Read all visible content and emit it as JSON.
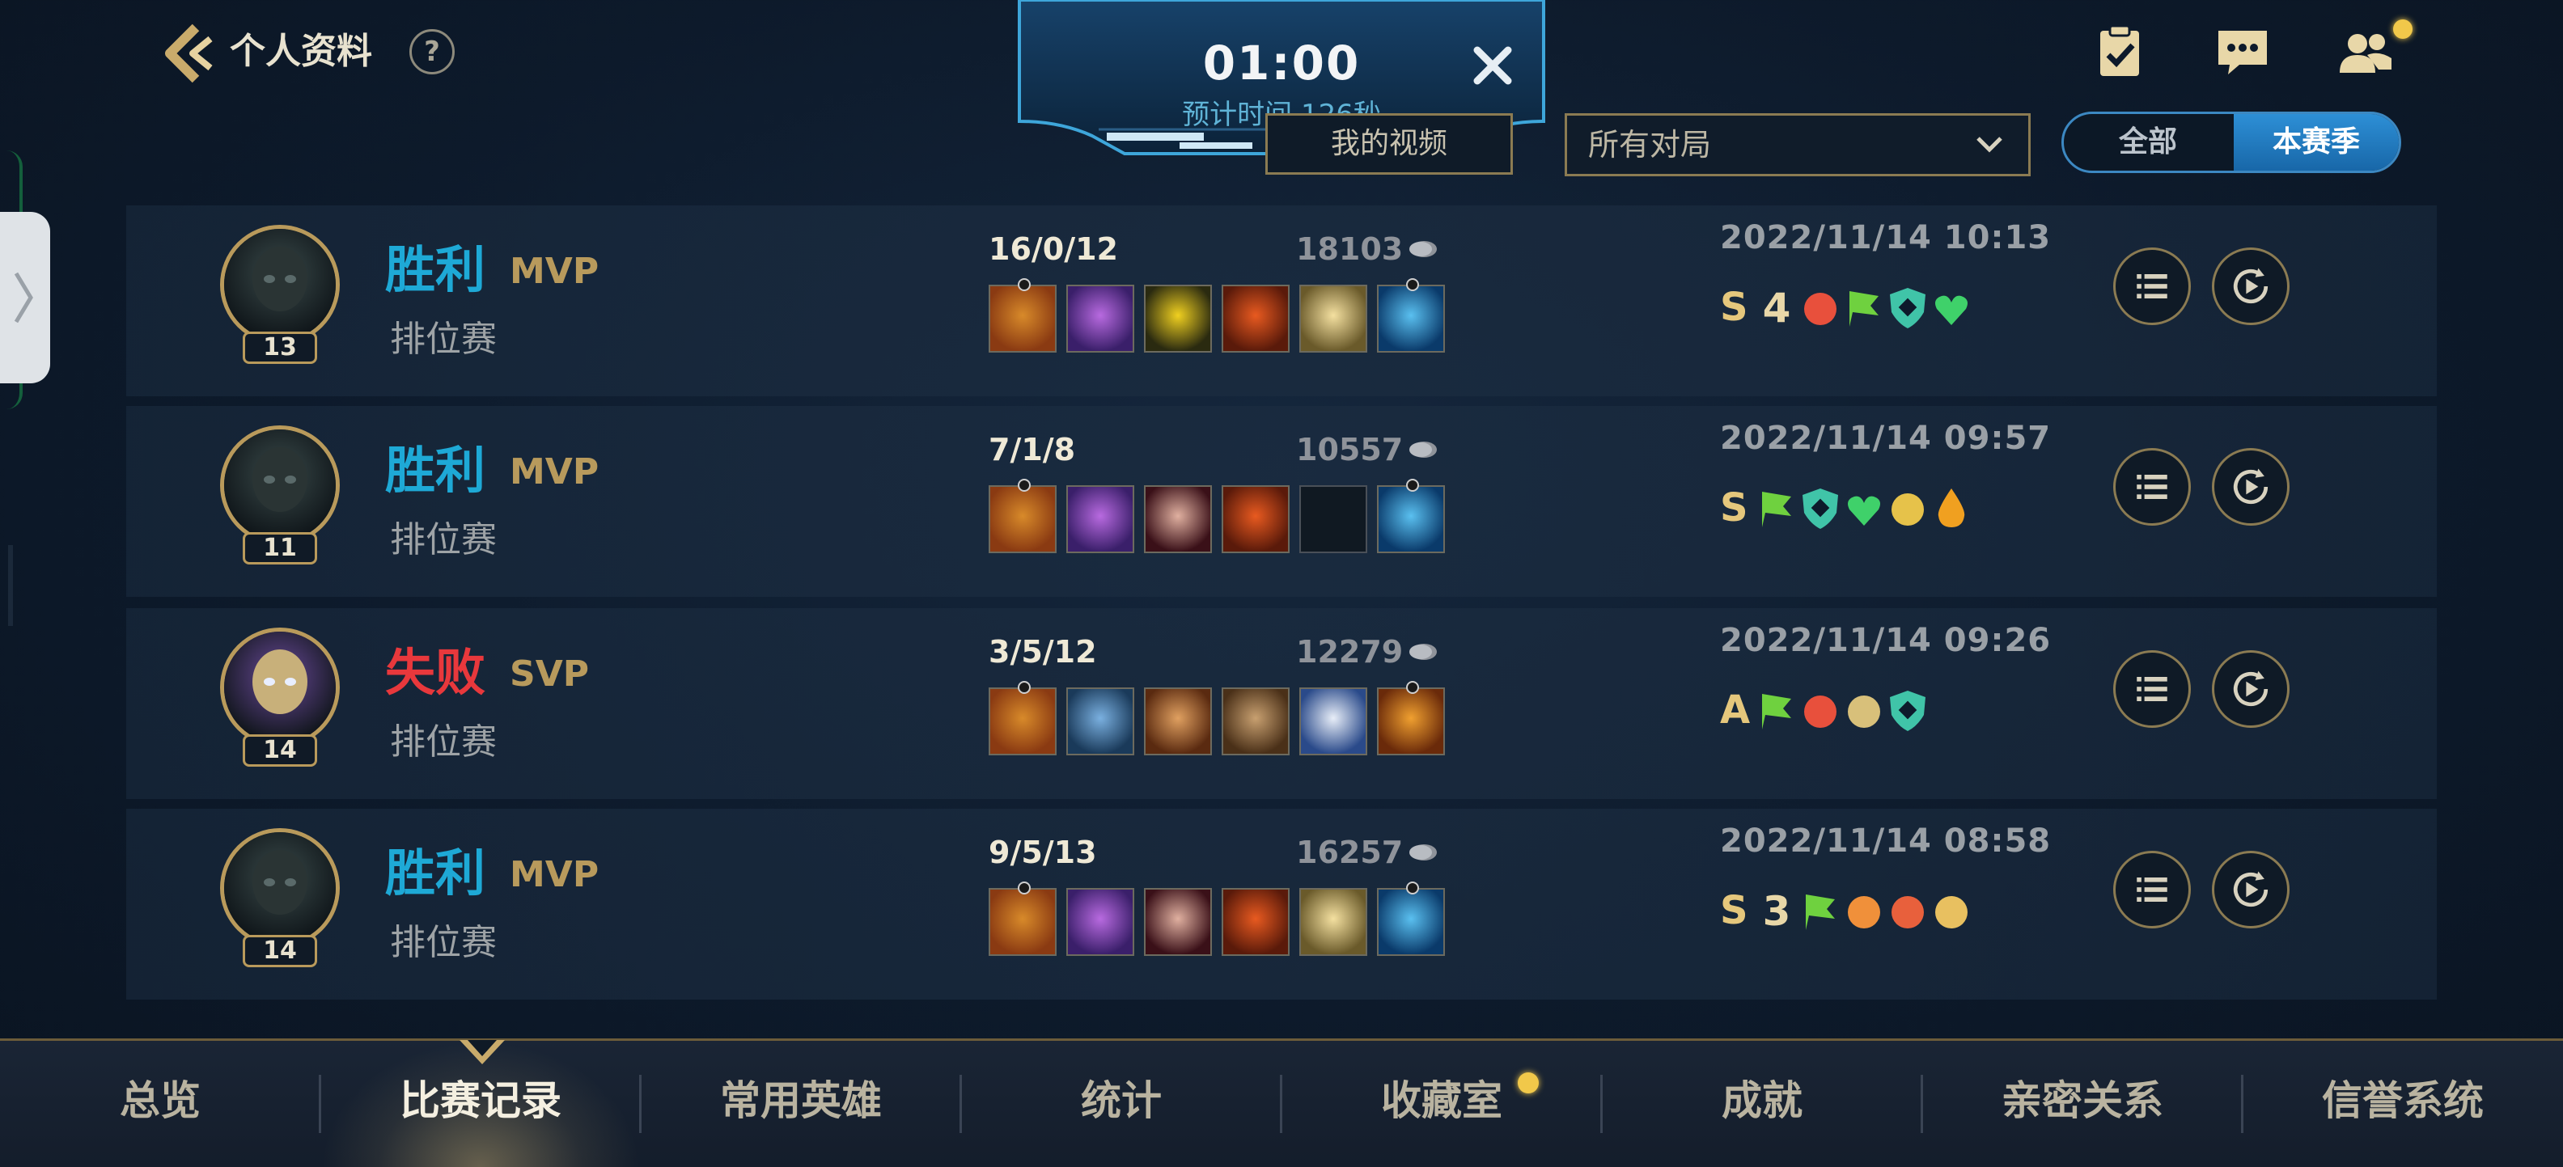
{
  "header": {
    "title": "个人资料",
    "help": "?"
  },
  "queue": {
    "time": "01:00",
    "estimate": "预计时间 126秒"
  },
  "filters": {
    "my_video": "我的视频",
    "match_type": "所有对局",
    "toggle_all": "全部",
    "toggle_season": "本赛季"
  },
  "matches": [
    {
      "level": "13",
      "result": "胜利",
      "outcome": "win",
      "title": "MVP",
      "mode": "排位赛",
      "kda": "16/0/12",
      "gold": "18103",
      "date": "2022/11/14 10:13",
      "grade": "S",
      "items": [
        "item-a",
        "item-b",
        "item-c",
        "item-d",
        "item-e",
        "item-f"
      ],
      "badges": [
        "rank-4-badge",
        "flower-badge",
        "flag-badge",
        "shield-badge",
        "heal-badge"
      ]
    },
    {
      "level": "11",
      "result": "胜利",
      "outcome": "win",
      "title": "MVP",
      "mode": "排位赛",
      "kda": "7/1/8",
      "gold": "10557",
      "date": "2022/11/14 09:57",
      "grade": "S",
      "items": [
        "item-a",
        "item-b",
        "item-g",
        "item-d",
        "empty",
        "item-f"
      ],
      "badges": [
        "flag-badge",
        "shield-badge",
        "heal-badge",
        "tower-badge",
        "drop-badge"
      ]
    },
    {
      "level": "14",
      "result": "失败",
      "outcome": "loss",
      "title": "SVP",
      "mode": "排位赛",
      "kda": "3/5/12",
      "gold": "12279",
      "date": "2022/11/14 09:26",
      "grade": "A",
      "items": [
        "item-a",
        "item-h",
        "item-i",
        "item-j",
        "item-k",
        "item-l"
      ],
      "badges": [
        "flag-badge",
        "flower-badge",
        "clock-badge",
        "shield-badge"
      ]
    },
    {
      "level": "14",
      "result": "胜利",
      "outcome": "win",
      "title": "MVP",
      "mode": "排位赛",
      "kda": "9/5/13",
      "gold": "16257",
      "date": "2022/11/14 08:58",
      "grade": "S",
      "items": [
        "item-a",
        "item-b",
        "item-g",
        "item-d",
        "item-e",
        "item-f"
      ],
      "badges": [
        "rank-3-badge",
        "flag-badge",
        "fist-badge",
        "dragon-badge",
        "coin-badge"
      ]
    }
  ],
  "nav": [
    "总览",
    "比赛记录",
    "常用英雄",
    "统计",
    "收藏室",
    "成就",
    "亲密关系",
    "信誉系统"
  ],
  "colors": {
    "win": "#1ea9d6",
    "loss": "#e8383c",
    "gold_trim": "#b99a5b",
    "accent_blue": "#2d8fd6"
  }
}
